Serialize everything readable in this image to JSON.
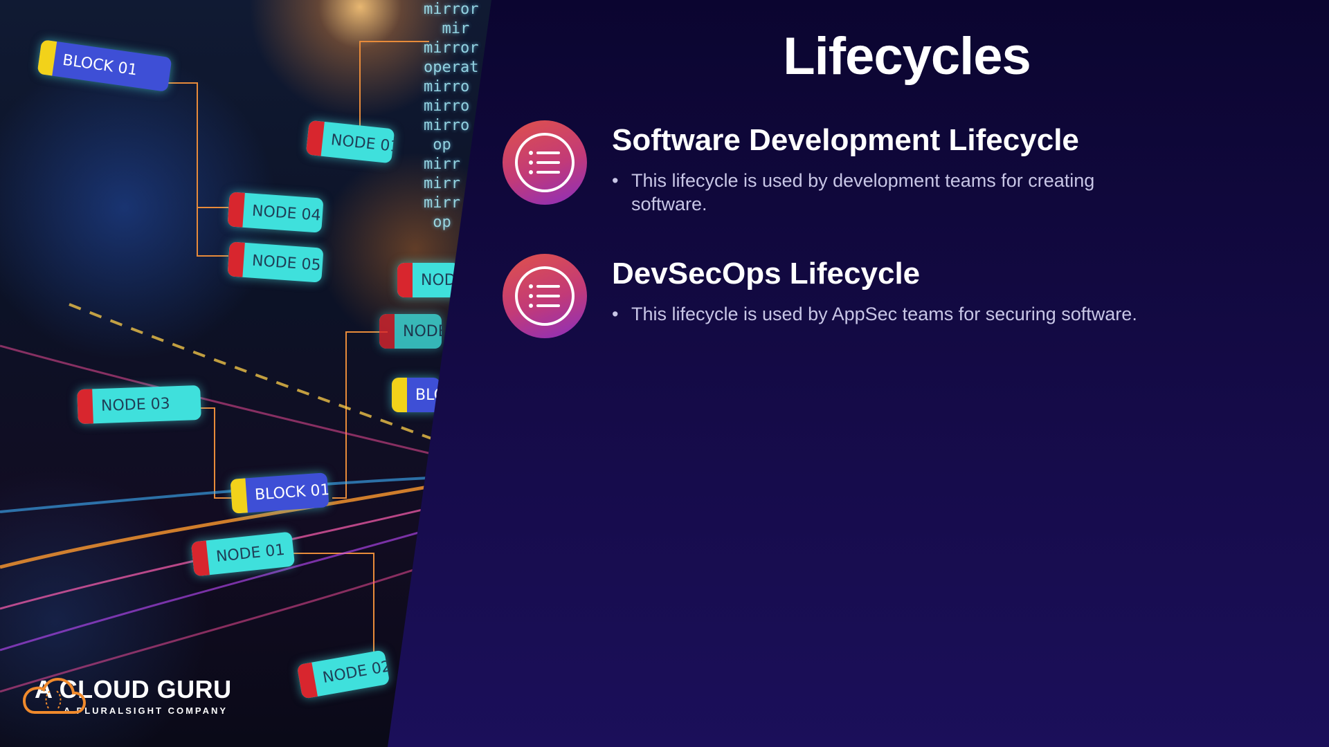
{
  "slide": {
    "title": "Lifecycles",
    "items": [
      {
        "icon": "list-icon",
        "heading": "Software Development Lifecycle",
        "bullet": "This lifecycle is used by development teams for creating software."
      },
      {
        "icon": "list-icon",
        "heading": "DevSecOps Lifecycle",
        "bullet": "This lifecycle is used by AppSec teams for securing software."
      }
    ]
  },
  "photo": {
    "nodes": [
      "BLOCK 01",
      "NODE 01",
      "NODE 04",
      "NODE 05",
      "NODE",
      "NODE",
      "NODE 03",
      "BLOC",
      "BLOCK 01",
      "NODE 01",
      "NODE 02"
    ]
  },
  "branding": {
    "logo_name": "A CLOUD GURU",
    "logo_tagline": "A PLURALSIGHT COMPANY"
  },
  "colors": {
    "background": "#14093f",
    "icon_gradient_start": "#e0524a",
    "icon_gradient_end": "#8a2fbf",
    "heading": "#ffffff",
    "body_text": "#c8c6e6",
    "logo_orange": "#f08a2c"
  }
}
